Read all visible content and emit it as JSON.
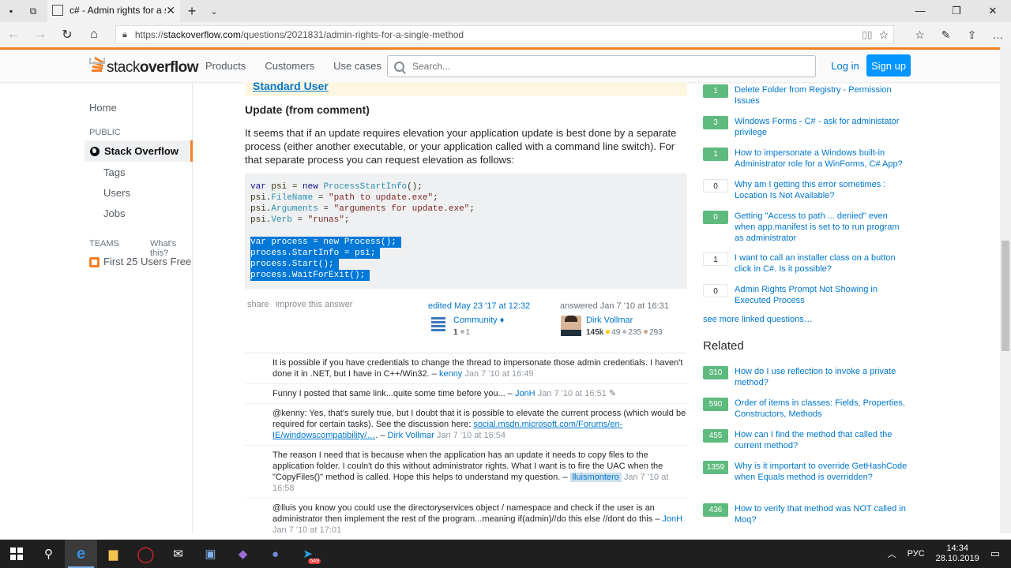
{
  "browser": {
    "tab_title": "c# - Admin rights for a s",
    "url_prefix": "https://",
    "url_host": "stackoverflow.com",
    "url_path": "/questions/2021831/admin-rights-for-a-single-method"
  },
  "header": {
    "logo_light": "stack",
    "logo_bold": "overflow",
    "nav": [
      "Products",
      "Customers",
      "Use cases"
    ],
    "search_placeholder": "Search...",
    "login": "Log in",
    "signup": "Sign up"
  },
  "sidebar": {
    "home": "Home",
    "public": "PUBLIC",
    "stackoverflow": "Stack Overflow",
    "tags": "Tags",
    "users": "Users",
    "jobs": "Jobs",
    "teams": "TEAMS",
    "whats_this": "What's this?",
    "first25": "First 25 Users Free"
  },
  "answer": {
    "notice_link": "Standard User",
    "update_heading": "Update (from comment)",
    "paragraph": "It seems that if an update requires elevation your application update is best done by a separate process (either another executable, or your application called with a command line switch). For that separate process you can request elevation as follows:",
    "share": "share",
    "improve": "improve this answer",
    "edited": "edited May 23 '17 at 12:32",
    "editor_name": "Community",
    "editor_diamond": "♦",
    "editor_rep": "1",
    "editor_silver": "1",
    "answered": "answered Jan 7 '10 at 16:31",
    "author_name": "Dirk Vollmar",
    "author_rep": "145k",
    "author_gold": "49",
    "author_silver": "235",
    "author_bronze": "293"
  },
  "code": {
    "l1_a": "var",
    "l1_b": " psi = ",
    "l1_c": "new",
    "l1_d": " ",
    "l1_e": "ProcessStartInfo",
    "l1_f": "();",
    "l2_a": "psi.",
    "l2_b": "FileName",
    "l2_c": " = ",
    "l2_d": "\"path to update.exe\"",
    "l2_e": ";",
    "l3_a": "psi.",
    "l3_b": "Arguments",
    "l3_c": " = ",
    "l3_d": "\"arguments for update.exe\"",
    "l3_e": ";",
    "l4_a": "psi.",
    "l4_b": "Verb",
    "l4_c": " = ",
    "l4_d": "\"runas\"",
    "l4_e": ";",
    "s1": "var process = new Process();",
    "s2": "process.StartInfo = psi;",
    "s3": "process.Start();",
    "s4": "process.WaitForExit();"
  },
  "comments": [
    {
      "text": "It is possible if you have credentials to change the thread to impersonate those admin credentials. I haven't done it in .NET, but I have in C++/Win32. – ",
      "user": "kenny",
      "date": "Jan 7 '10 at 16:49"
    },
    {
      "text": "Funny I posted that same link...quite some time before you... – ",
      "user": "JonH",
      "date": "Jan 7 '10 at 16:51",
      "edit": "✎"
    },
    {
      "text": "@kenny: Yes, that's surely true, but I doubt that it is possible to elevate the current process (which would be required for certain tasks). See the discussion here: ",
      "link": "social.msdn.microsoft.com/Forums/en-IE/windowscompatibility/…",
      "after": ". – ",
      "user": "Dirk Vollmar",
      "date": "Jan 7 '10 at 16:54"
    },
    {
      "text": "The reason I need that is because when the application has an update it needs to copy files to the application folder. I couln't do this without administrator rights. What I want is to fire the UAC when the \"CopyFiles()\" method is called. Hope this helps to understand my question. – ",
      "user": "lluismontero",
      "date": "Jan 7 '10 at 16:58"
    },
    {
      "text": "@lluis you know you could use the directoryservices object / namespace and check if the user is an administrator then implement the rest of the program...meaning if(admin)//do this else //dont do this – ",
      "user": "JonH",
      "date": "Jan 7 '10 at 17:01"
    }
  ],
  "linked": [
    {
      "score": "1",
      "title": "Delete Folder from Registry - Permission Issues"
    },
    {
      "score": "3",
      "title": "Windows Forms - C# - ask for administator privilege"
    },
    {
      "score": "1",
      "title": "How to impersonate a Windows built-in Administrator role for a WinForms, C# App?"
    },
    {
      "score": "0",
      "title": "Why am I getting this error sometimes : Location Is Not Available?"
    },
    {
      "score": "0",
      "title": "Getting \"Access to path ... denied\" even when app.manifest is set to to run program as administrator"
    },
    {
      "score": "1",
      "title": "I want to call an installer class on a button click in C#. Is it possible?"
    },
    {
      "score": "0",
      "title": "Admin Rights Prompt Not Showing in Executed Process"
    }
  ],
  "see_more": "see more linked questions…",
  "related_heading": "Related",
  "related": [
    {
      "score": "310",
      "title": "How do I use reflection to invoke a private method?"
    },
    {
      "score": "590",
      "title": "Order of items in classes: Fields, Properties, Constructors, Methods"
    },
    {
      "score": "455",
      "title": "How can I find the method that called the current method?"
    },
    {
      "score": "1359",
      "title": "Why is it important to override GetHashCode when Equals method is overridden?"
    },
    {
      "score": "436",
      "title": "How to verify that method was NOT called in Moq?"
    }
  ],
  "taskbar": {
    "lang": "РУС",
    "time": "14:34",
    "date": "28.10.2019",
    "telegram_badge": "549"
  }
}
